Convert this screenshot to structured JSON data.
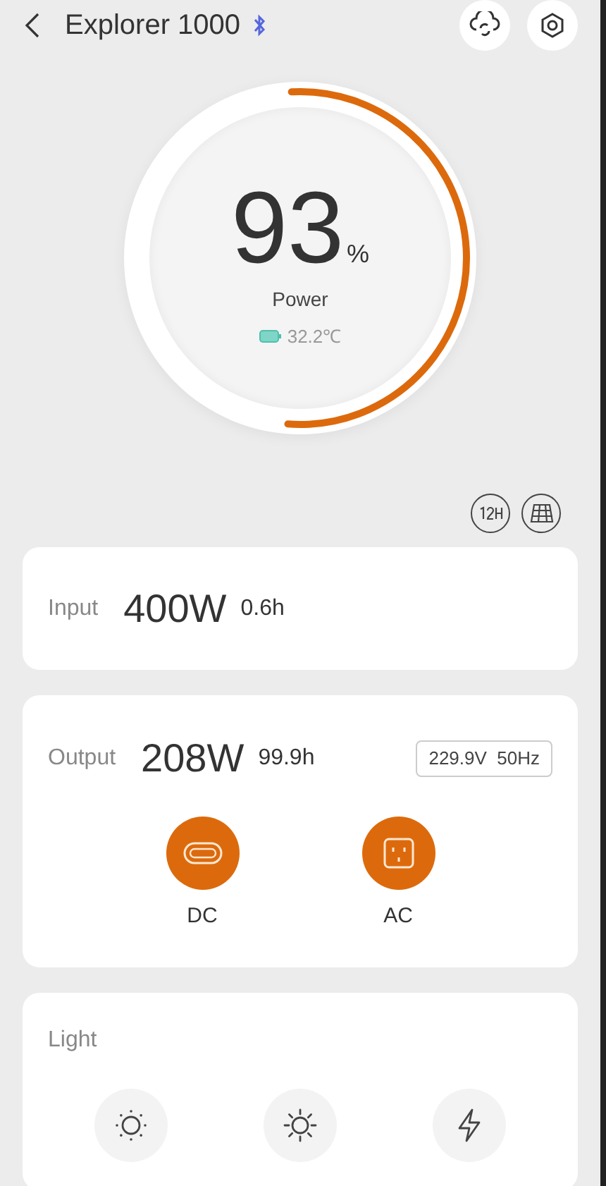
{
  "header": {
    "title": "Explorer 1000"
  },
  "gauge": {
    "value": "93",
    "unit": "%",
    "label": "Power",
    "temperature": "32.2℃",
    "level": 0.52
  },
  "input": {
    "label": "Input",
    "watts": "400W",
    "time": "0.6h"
  },
  "output": {
    "label": "Output",
    "watts": "208W",
    "time": "99.9h",
    "reading": "229.9V  50Hz",
    "ports": [
      {
        "kind": "dc",
        "label": "DC",
        "on": true
      },
      {
        "kind": "ac",
        "label": "AC",
        "on": true
      }
    ]
  },
  "light": {
    "label": "Light",
    "modes": [
      {
        "kind": "low",
        "on": false
      },
      {
        "kind": "high",
        "on": false
      },
      {
        "kind": "flash",
        "on": false
      }
    ]
  }
}
